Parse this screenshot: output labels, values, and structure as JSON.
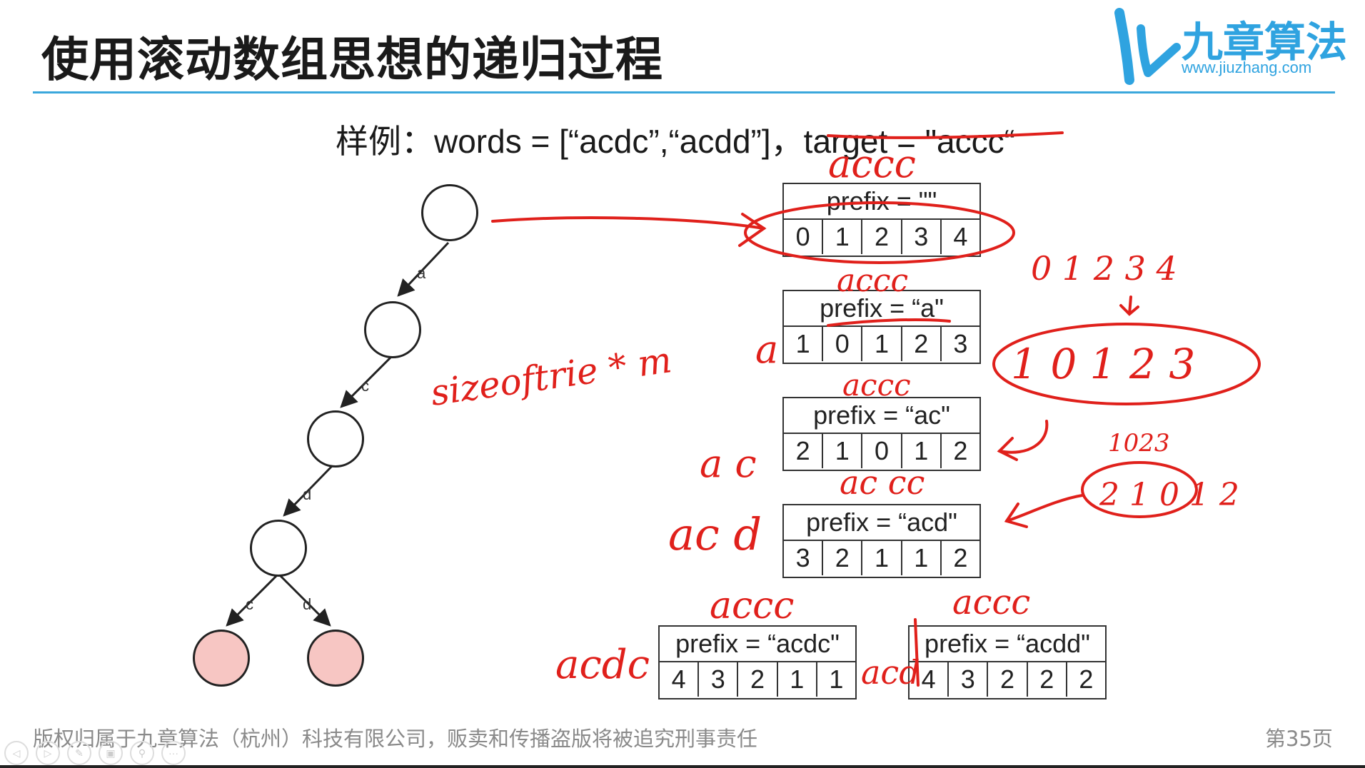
{
  "slide": {
    "title": "使用滚动数组思想的递归过程",
    "logo": {
      "name": "九章算法",
      "url": "www.jiuzhang.com"
    },
    "sample": {
      "prefix": "样例：",
      "words": "words = [“acdc”,“acdd”]，",
      "target": "target = \"accc“"
    },
    "footer": "版权归属于九章算法（杭州）科技有限公司，贩卖和传播盗版将被追究刑事责任",
    "page_number": "第35页"
  },
  "trie": {
    "edges": [
      "a",
      "c",
      "d",
      "c",
      "d"
    ]
  },
  "tables": [
    {
      "prefix": "prefix = \"\"",
      "cells": [
        "0",
        "1",
        "2",
        "3",
        "4"
      ]
    },
    {
      "prefix": "prefix = “a\"",
      "cells": [
        "1",
        "0",
        "1",
        "2",
        "3"
      ]
    },
    {
      "prefix": "prefix = “ac\"",
      "cells": [
        "2",
        "1",
        "0",
        "1",
        "2"
      ]
    },
    {
      "prefix": "prefix = “acd\"",
      "cells": [
        "3",
        "2",
        "1",
        "1",
        "2"
      ]
    },
    {
      "prefix": "prefix = “acdc\"",
      "cells": [
        "4",
        "3",
        "2",
        "1",
        "1"
      ]
    },
    {
      "prefix": "prefix = “acdd\"",
      "cells": [
        "4",
        "3",
        "2",
        "2",
        "2"
      ]
    }
  ],
  "annotations": {
    "color": "#e0201b",
    "above_tables": [
      "accc",
      "accc",
      "accc",
      "ac cc",
      "accc",
      "accc"
    ],
    "left_of_tables": [
      "a",
      "a c",
      "ac d",
      "acdc",
      "acd"
    ],
    "size_note": "sizeoftrie * m",
    "top_right_row": "0 1 2 3 4",
    "big_oval_row": "1 0 1 2 3",
    "small_upper": "1023",
    "small_lower": "2 1 0 1 2"
  }
}
